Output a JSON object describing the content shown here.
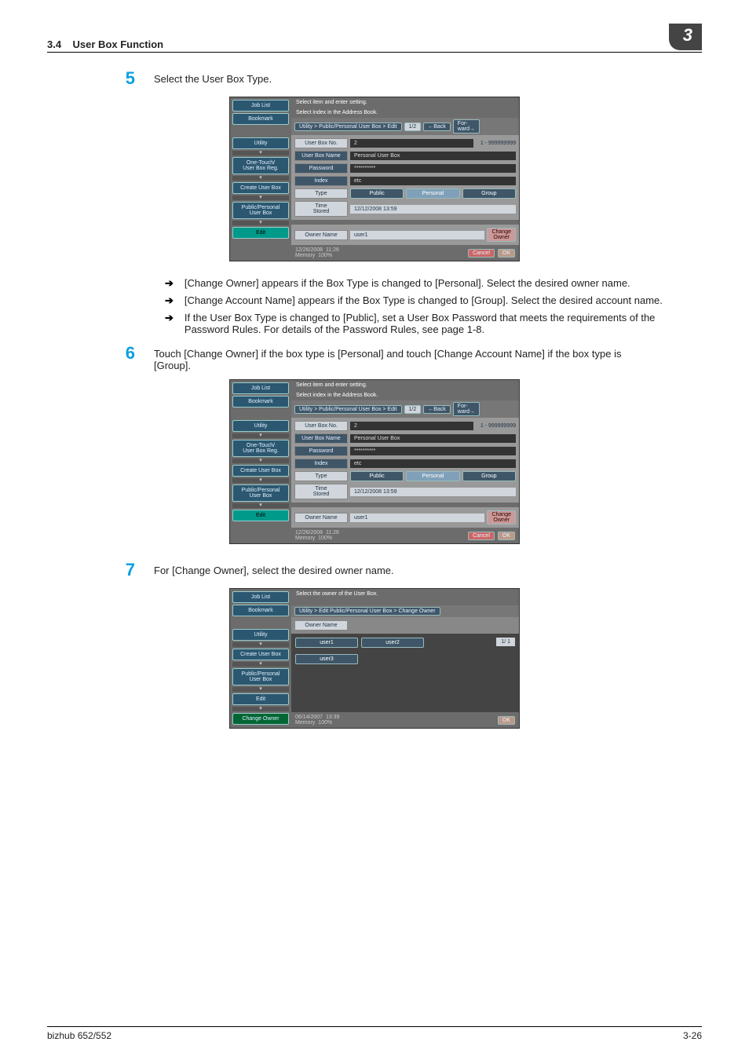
{
  "header": {
    "section": "3.4",
    "title": "User Box Function",
    "chapter": "3"
  },
  "steps": {
    "s5": {
      "num": "5",
      "text": "Select the User Box Type."
    },
    "s6": {
      "num": "6",
      "text": "Touch [Change Owner] if the box type is [Personal] and touch [Change Account Name] if the box type is [Group]."
    },
    "s7": {
      "num": "7",
      "text": "For [Change Owner], select the desired owner name."
    }
  },
  "bullets": {
    "b1": "[Change Owner] appears if the Box Type is changed to [Personal]. Select the desired owner name.",
    "b2": "[Change Account Name] appears if the Box Type is changed to [Group]. Select the desired account name.",
    "b3": "If the User Box Type is changed to [Public], set a User Box Password that meets the requirements of the Password Rules. For details of the Password Rules, see page 1-8."
  },
  "screen1": {
    "sidebar": {
      "joblist": "Job List",
      "bookmark": "Bookmark",
      "utility": "Utility",
      "onetouch": "One-Touch/\nUser Box Reg.",
      "create": "Create User Box",
      "pp": "Public/Personal\nUser Box",
      "edit": "Edit"
    },
    "title1": "Select item and enter setting.",
    "title2": "Select index in the Address Book.",
    "crumb": "Utility > Public/Personal User  Box > Edit",
    "page": "1/2",
    "back": "Back",
    "forward": "For-\nward",
    "labels": {
      "no": "User Box No.",
      "name": "User Box Name",
      "pwd": "Password",
      "index": "Index",
      "type": "Type",
      "time": "Time\nStored",
      "owner": "Owner Name"
    },
    "values": {
      "no": "2",
      "name": "Personal User Box",
      "pwd": "**********",
      "index": "etc",
      "time": "12/12/2008  13:59",
      "owner": "user1"
    },
    "range": "1 - 999999999",
    "types": {
      "public": "Public",
      "personal": "Personal",
      "group": "Group"
    },
    "change": "Change\nOwner",
    "foot": {
      "date": "12/26/2008",
      "time": "11:26",
      "mem": "Memory",
      "memv": "100%",
      "cancel": "Cancel",
      "ok": "OK"
    }
  },
  "screen3": {
    "sidebar": {
      "joblist": "Job List",
      "bookmark": "Bookmark",
      "utility": "Utility",
      "create": "Create User Box",
      "pp": "Public/Personal\nUser Box",
      "edit": "Edit",
      "chg": "Change Owner"
    },
    "title1": "Select the owner of the User Box.",
    "crumb": "Utility > Edit Public/Personal User Box > Change Owner",
    "ownerlbl": "Owner Name",
    "users": {
      "u1": "user1",
      "u2": "user2",
      "u3": "user3"
    },
    "page": "1/  1",
    "foot": {
      "date": "06/14/2007",
      "time": "13:39",
      "mem": "Memory",
      "memv": "100%",
      "ok": "OK"
    }
  },
  "footer": {
    "left": "bizhub 652/552",
    "right": "3-26"
  }
}
